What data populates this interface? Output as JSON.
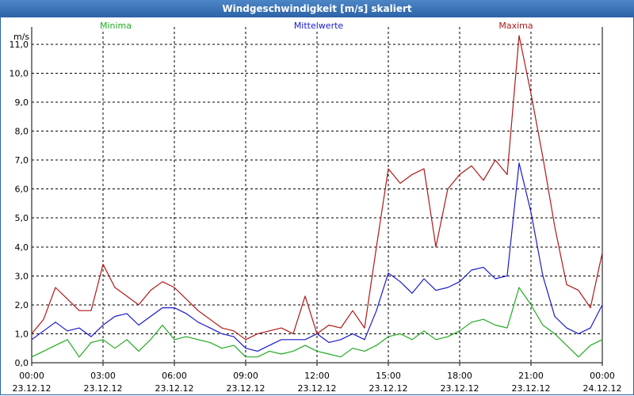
{
  "window": {
    "title": "Windgeschwindigkeit [m/s] skaliert"
  },
  "chart_data": {
    "type": "line",
    "ylabel": "m/s",
    "ylim": [
      0,
      11.6
    ],
    "yticks": [
      "0,0",
      "1,0",
      "2,0",
      "3,0",
      "4,0",
      "5,0",
      "6,0",
      "7,0",
      "8,0",
      "9,0",
      "10,0",
      "11,0"
    ],
    "xlim_hours": [
      0,
      24
    ],
    "xtick_times": [
      "00:00",
      "03:00",
      "06:00",
      "09:00",
      "12:00",
      "15:00",
      "18:00",
      "21:00",
      "00:00"
    ],
    "xtick_dates": [
      "23.12.12",
      "23.12.12",
      "23.12.12",
      "23.12.12",
      "23.12.12",
      "23.12.12",
      "23.12.12",
      "23.12.12",
      "24.12.12"
    ],
    "grid": true,
    "legend": "top-inline",
    "series": [
      {
        "name": "Minima",
        "color": "#22aa22",
        "x": [
          0,
          0.5,
          1,
          1.5,
          2,
          2.5,
          3,
          3.5,
          4,
          4.5,
          5,
          5.5,
          6,
          6.5,
          7,
          7.5,
          8,
          8.5,
          9,
          9.5,
          10,
          10.5,
          11,
          11.5,
          12,
          12.5,
          13,
          13.5,
          14,
          14.5,
          15,
          15.5,
          16,
          16.5,
          17,
          17.5,
          18,
          18.5,
          19,
          19.5,
          20,
          20.5,
          21,
          21.5,
          22,
          22.5,
          23,
          23.5,
          24
        ],
        "y": [
          0.2,
          0.4,
          0.6,
          0.8,
          0.2,
          0.7,
          0.8,
          0.5,
          0.8,
          0.4,
          0.8,
          1.3,
          0.8,
          0.9,
          0.8,
          0.7,
          0.5,
          0.6,
          0.2,
          0.2,
          0.4,
          0.3,
          0.4,
          0.6,
          0.4,
          0.3,
          0.2,
          0.5,
          0.4,
          0.6,
          0.9,
          1.0,
          0.8,
          1.1,
          0.8,
          0.9,
          1.1,
          1.4,
          1.5,
          1.3,
          1.2,
          2.6,
          2.0,
          1.3,
          1.0,
          0.6,
          0.2,
          0.6,
          0.8
        ]
      },
      {
        "name": "Mittelwerte",
        "color": "#1a1acc",
        "x": [
          0,
          0.5,
          1,
          1.5,
          2,
          2.5,
          3,
          3.5,
          4,
          4.5,
          5,
          5.5,
          6,
          6.5,
          7,
          7.5,
          8,
          8.5,
          9,
          9.5,
          10,
          10.5,
          11,
          11.5,
          12,
          12.5,
          13,
          13.5,
          14,
          14.5,
          15,
          15.5,
          16,
          16.5,
          17,
          17.5,
          18,
          18.5,
          19,
          19.5,
          20,
          20.5,
          21,
          21.5,
          22,
          22.5,
          23,
          23.5,
          24
        ],
        "y": [
          0.8,
          1.1,
          1.4,
          1.1,
          1.2,
          0.9,
          1.3,
          1.6,
          1.7,
          1.3,
          1.6,
          1.9,
          1.9,
          1.7,
          1.4,
          1.2,
          1.0,
          0.9,
          0.5,
          0.4,
          0.6,
          0.8,
          0.8,
          0.8,
          1.0,
          0.7,
          0.8,
          1.0,
          0.8,
          1.8,
          3.1,
          2.8,
          2.4,
          2.9,
          2.5,
          2.6,
          2.8,
          3.2,
          3.3,
          2.9,
          3.0,
          6.9,
          5.2,
          3.0,
          1.6,
          1.2,
          1.0,
          1.2,
          2.0
        ]
      },
      {
        "name": "Maxima",
        "color": "#b01818",
        "x": [
          0,
          0.5,
          1,
          1.5,
          2,
          2.5,
          3,
          3.5,
          4,
          4.5,
          5,
          5.5,
          6,
          6.5,
          7,
          7.5,
          8,
          8.5,
          9,
          9.5,
          10,
          10.5,
          11,
          11.5,
          12,
          12.5,
          13,
          13.5,
          14,
          14.5,
          15,
          15.5,
          16,
          16.5,
          17,
          17.5,
          18,
          18.5,
          19,
          19.5,
          20,
          20.5,
          21,
          21.5,
          22,
          22.5,
          23,
          23.5,
          24
        ],
        "y": [
          1.0,
          1.5,
          2.6,
          2.2,
          1.8,
          1.8,
          3.4,
          2.6,
          2.3,
          2.0,
          2.5,
          2.8,
          2.6,
          2.2,
          1.8,
          1.5,
          1.2,
          1.1,
          0.8,
          1.0,
          1.1,
          1.2,
          1.0,
          2.3,
          1.0,
          1.3,
          1.2,
          1.8,
          1.2,
          4.0,
          6.7,
          6.2,
          6.5,
          6.7,
          4.0,
          6.0,
          6.5,
          6.8,
          6.3,
          7.0,
          6.5,
          11.3,
          9.3,
          7.1,
          4.7,
          2.7,
          2.5,
          1.9,
          3.8
        ]
      }
    ]
  }
}
